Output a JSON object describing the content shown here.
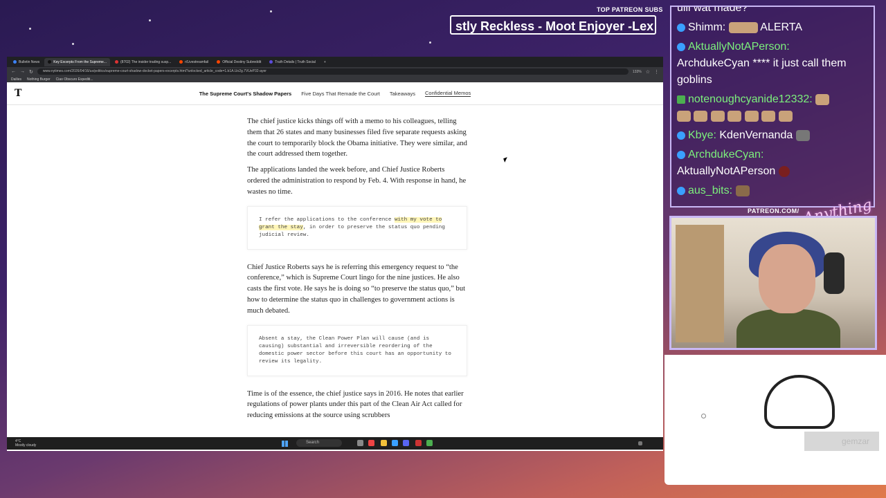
{
  "overlay": {
    "top_patreon_label": "TOP PATREON SUBS",
    "ticker_text": "stly Reckless - Moot Enjoyer -Lex",
    "patreon_label": "PATREON.COM/",
    "script_logo": "Anything Else"
  },
  "browser": {
    "tabs": [
      {
        "label": "Bulletin News"
      },
      {
        "label": "Key Excerpts From the Supreme..."
      },
      {
        "label": "(8702) The insider trading susp..."
      },
      {
        "label": "r/Livestreamfail"
      },
      {
        "label": "Official Destiny Subreddit"
      },
      {
        "label": "Truth Details | Truth Social"
      }
    ],
    "new_tab": "+",
    "url": "www.nytimes.com/2026/04/16/us/politics/supreme-court-shadow-docket-papers-excerpts.html?unlocked_article_code=1.b1A.Uo2g.7VUeP32-ayer",
    "zoom": "133%",
    "bookmarks": [
      "Dailies",
      "Nothing Burger",
      "Ciao Obscuro Expediti..."
    ]
  },
  "nyt": {
    "logo": "T",
    "nav": {
      "title": "The Supreme Court's Shadow Papers",
      "link1": "Five Days That Remade the Court",
      "link2": "Takeaways",
      "link3": "Confidential Memos"
    },
    "p1": "The chief justice kicks things off with a memo to his colleagues, telling them that 26 states and many businesses filed five separate requests asking the court to temporarily block the Obama initiative. They were similar, and the court addressed them together.",
    "p2": "The applications landed the week before, and Chief Justice Roberts ordered the administration to respond by Feb. 4. With response in hand, he wastes no time.",
    "q1_pre": "I refer the applications to the conference ",
    "q1_hl": "with my vote to grant the stay",
    "q1_post": ", in order to preserve the status quo pending judicial review.",
    "p3": "Chief Justice Roberts says he is referring this emergency request to “the conference,” which is Supreme Court lingo for the nine justices. He also casts the first vote. He says he is doing so “to preserve the status quo,” but how to determine the status quo in challenges to government actions is much debated.",
    "q2": "Absent a stay, the Clean Power Plan will cause (and is causing) substantial and irreversible reordering of the domestic power sector before this court has an opportunity to review its legality.",
    "p4": "Time is of the essence, the chief justice says in 2016. He notes that earlier regulations of power plants under this part of the Clean Air Act called for reducing emissions at the source using scrubbers"
  },
  "taskbar": {
    "temp": "4°C",
    "weather": "Mostly cloudy",
    "search": "Search"
  },
  "chat": {
    "top_partial": "ulll wat made?",
    "m1_user": "Shimm:",
    "m1_text": "ALERTA",
    "m2_user": "AktuallyNotAPerson:",
    "m2_text": "ArchdukeCyan **** it just call them goblins",
    "m3_user": "notenoughcyanide12332:",
    "m4_user": "Kbye:",
    "m4_text": "KdenVernanda",
    "m5_user": "ArchdukeCyan:",
    "m5_text": "AktuallyNotAPerson",
    "m6_user": "aus_bits:"
  },
  "avatar_name": "gemzar"
}
